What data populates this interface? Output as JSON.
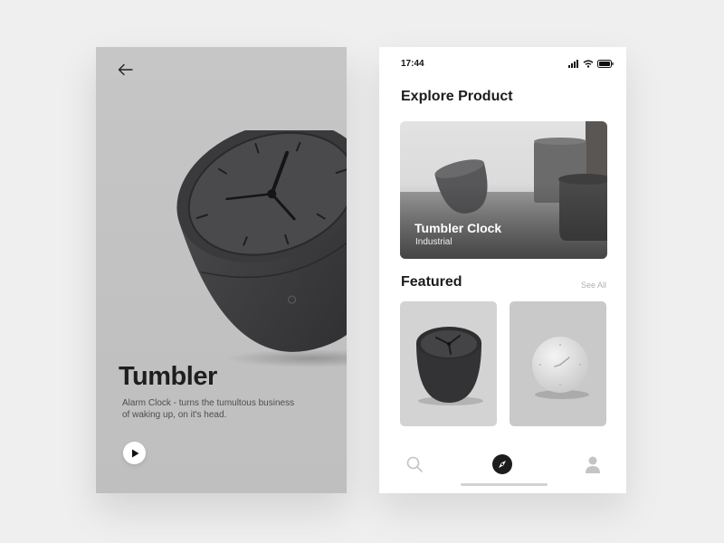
{
  "detail": {
    "title": "Tumbler",
    "description": "Alarm Clock - turns the tumultous business of waking up, on it's head.",
    "back_icon": "arrow-left-icon",
    "play_icon": "play-icon"
  },
  "status_bar": {
    "time": "17:44",
    "icons": [
      "signal-icon",
      "wifi-icon",
      "battery-icon"
    ]
  },
  "explore": {
    "title": "Explore Product",
    "card": {
      "title": "Tumbler Clock",
      "subtitle": "Industrial"
    }
  },
  "featured": {
    "title": "Featured",
    "see_all_label": "See All",
    "items": [
      {
        "name": "dark-clock-image"
      },
      {
        "name": "white-clock-image"
      }
    ]
  },
  "tabbar": {
    "items": [
      "search-icon",
      "compass-icon",
      "user-icon"
    ],
    "active": "compass-icon"
  },
  "colors": {
    "page_bg": "#efefef",
    "left_screen_bg": "#c4c4c4",
    "product_dark": "#3a3a3c",
    "accent": "#1c1c1c"
  }
}
